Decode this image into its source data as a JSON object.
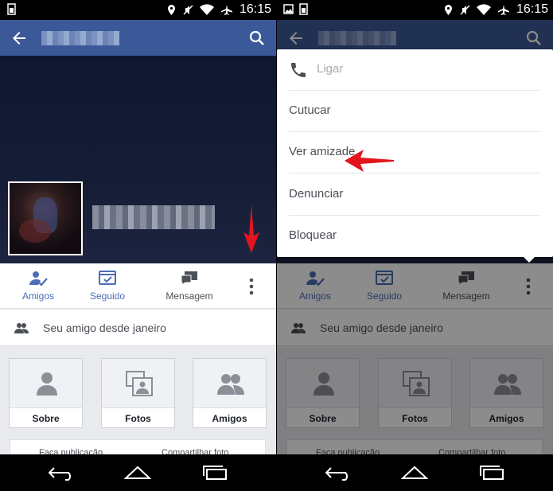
{
  "status_bar": {
    "time": "16:15"
  },
  "profile": {
    "actions": {
      "friends": "Amigos",
      "following": "Seguido",
      "message": "Mensagem"
    },
    "friend_since": "Seu amigo desde janeiro",
    "cards": [
      "Sobre",
      "Fotos",
      "Amigos"
    ],
    "bottom_row": {
      "left": "Faça publicação",
      "right": "Compartilhar foto"
    }
  },
  "menu": {
    "items": [
      "Ligar",
      "Cutucar",
      "Ver amizade",
      "Denunciar",
      "Bloquear"
    ]
  },
  "colors": {
    "brand_blue": "#3b5998",
    "action_blue": "#4b6cb7",
    "annotation_red": "#e3141b"
  }
}
